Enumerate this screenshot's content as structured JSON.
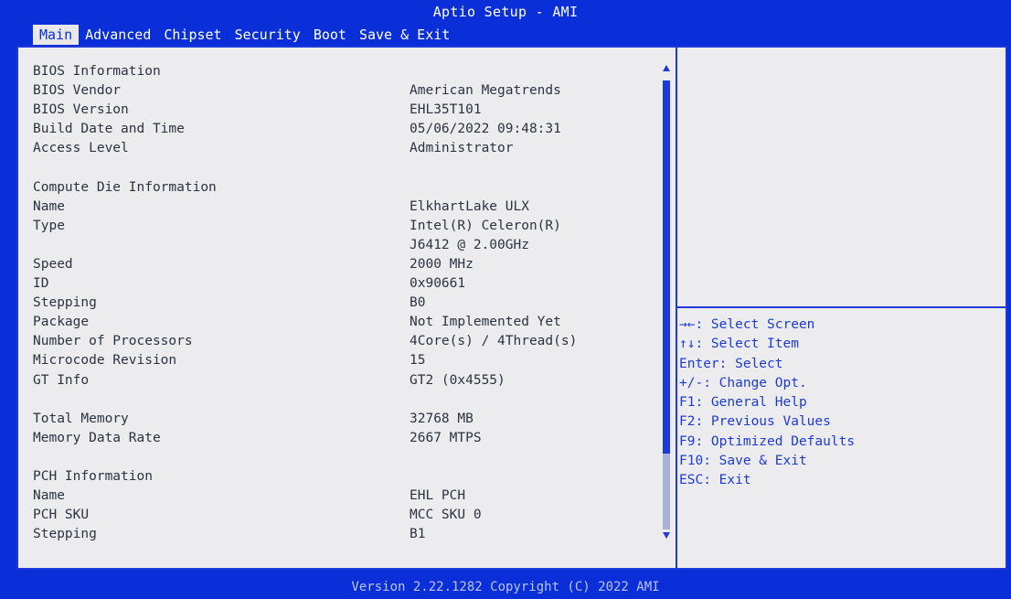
{
  "app": {
    "title": "Aptio Setup - AMI"
  },
  "tabs": [
    {
      "label": "Main",
      "active": true
    },
    {
      "label": "Advanced"
    },
    {
      "label": "Chipset"
    },
    {
      "label": "Security"
    },
    {
      "label": "Boot"
    },
    {
      "label": "Save & Exit"
    }
  ],
  "info": [
    {
      "label": "BIOS Information",
      "value": ""
    },
    {
      "label": "BIOS Vendor",
      "value": "American Megatrends"
    },
    {
      "label": "BIOS Version",
      "value": "EHL35T101"
    },
    {
      "label": "Build Date and Time",
      "value": "05/06/2022 09:48:31"
    },
    {
      "label": "Access Level",
      "value": "Administrator"
    },
    {
      "label": "",
      "value": ""
    },
    {
      "label": "Compute Die Information",
      "value": ""
    },
    {
      "label": "Name",
      "value": "ElkhartLake ULX"
    },
    {
      "label": "Type",
      "value": "Intel(R) Celeron(R)"
    },
    {
      "label": "",
      "value": "J6412 @ 2.00GHz"
    },
    {
      "label": "Speed",
      "value": "2000 MHz"
    },
    {
      "label": "ID",
      "value": "0x90661"
    },
    {
      "label": "Stepping",
      "value": "B0"
    },
    {
      "label": "Package",
      "value": "Not Implemented Yet"
    },
    {
      "label": "Number of Processors",
      "value": "4Core(s) / 4Thread(s)"
    },
    {
      "label": "Microcode Revision",
      "value": "15"
    },
    {
      "label": "GT Info",
      "value": "GT2 (0x4555)"
    },
    {
      "label": "",
      "value": ""
    },
    {
      "label": "Total Memory",
      "value": "32768 MB"
    },
    {
      "label": "Memory Data Rate",
      "value": " 2667 MTPS"
    },
    {
      "label": "",
      "value": ""
    },
    {
      "label": "PCH Information",
      "value": ""
    },
    {
      "label": "Name",
      "value": "EHL PCH"
    },
    {
      "label": "PCH SKU",
      "value": "MCC SKU 0"
    },
    {
      "label": "Stepping",
      "value": "B1"
    }
  ],
  "help": [
    "→←: Select Screen",
    "↑↓: Select Item",
    "Enter: Select",
    "+/-: Change Opt.",
    "F1: General Help",
    "F2: Previous Values",
    "F9: Optimized Defaults",
    "F10: Save & Exit",
    "ESC: Exit"
  ],
  "footer": {
    "version": "Version 2.22.1282 Copyright (C) 2022 AMI"
  },
  "colors": {
    "frame": "#0a2fd8",
    "panel": "#ececee",
    "text": "#2a3340",
    "help_text": "#1d3ad8"
  }
}
